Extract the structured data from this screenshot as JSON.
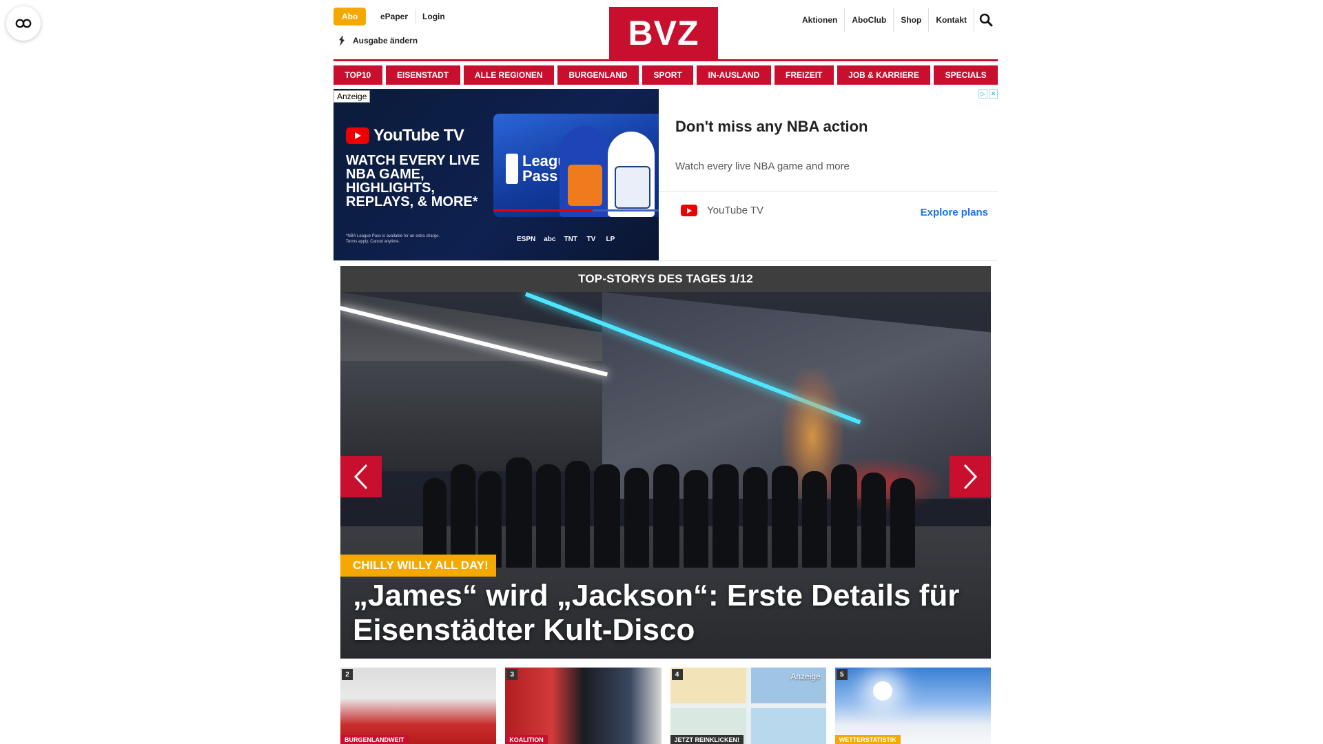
{
  "side_button": {
    "icon": "glasses-icon"
  },
  "header": {
    "abo": "Abo",
    "top_links": [
      "ePaper",
      "Login"
    ],
    "edition": "Ausgabe ändern",
    "logo": "BVZ",
    "right_links": [
      "Aktionen",
      "AboClub",
      "Shop",
      "Kontakt"
    ],
    "search_icon": "search-icon"
  },
  "nav": [
    "TOP10",
    "EISENSTADT",
    "ALLE REGIONEN",
    "BURGENLAND",
    "SPORT",
    "IN-AUSLAND",
    "FREIZEIT",
    "JOB & KARRIERE",
    "SPECIALS"
  ],
  "ad": {
    "tag": "Anzeige",
    "brand": "YouTube TV",
    "headline": "WATCH EVERY LIVE NBA GAME, HIGHLIGHTS, REPLAYS, & MORE*",
    "fine_print": "*NBA League Pass is available for an extra charge. Terms apply. Cancel anytime.",
    "panel_label": "League Pass",
    "networks": [
      "ESPN",
      "abc",
      "TNT",
      "TV",
      "LP"
    ],
    "title": "Don't miss any NBA action",
    "description": "Watch every live NBA game and more",
    "advertiser": "YouTube TV",
    "cta": "Explore plans",
    "video_progress": 0.6
  },
  "stories": {
    "heading": "TOP-STORYS DES TAGES 1/12",
    "kicker": "CHILLY WILLY ALL DAY!",
    "title": "„James“ wird „Jackson“: Erste Details für Eisenstädter Kult-Disco"
  },
  "thumbs": [
    {
      "num": "2",
      "category": "BURGENLANDWEIT"
    },
    {
      "num": "3",
      "category": "KOALITION"
    },
    {
      "num": "4",
      "category": "JETZT REINKLICKEN!",
      "label": "Anzeige"
    },
    {
      "num": "5",
      "category": "WETTERSTATISTIK"
    }
  ],
  "colors": {
    "brand_red": "#c8102e",
    "accent_orange": "#f5a800",
    "story_bar": "#3e3e3e"
  }
}
